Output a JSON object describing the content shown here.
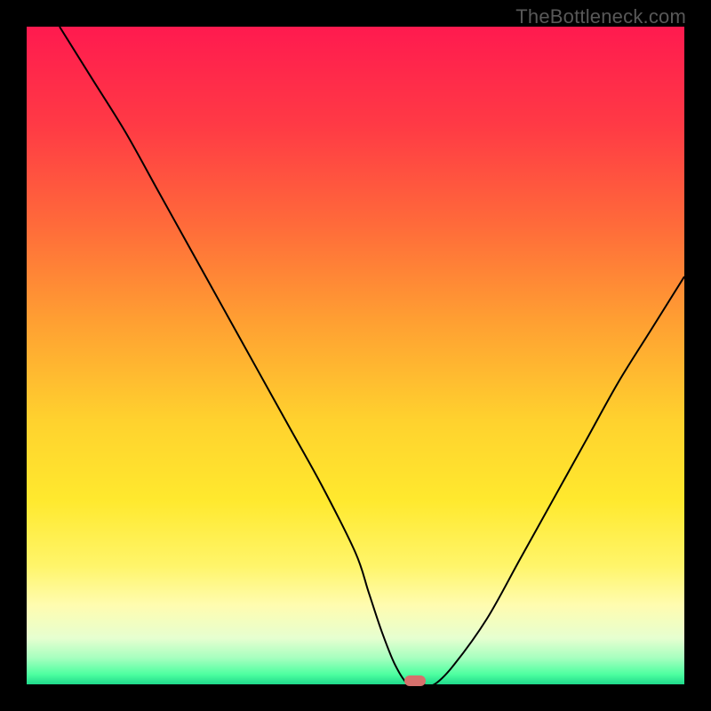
{
  "watermark": "TheBottleneck.com",
  "colors": {
    "curve": "#000000",
    "marker": "#d6706c",
    "gradient_stops": [
      {
        "offset": 0.0,
        "color": "#ff1a4f"
      },
      {
        "offset": 0.15,
        "color": "#ff3a45"
      },
      {
        "offset": 0.3,
        "color": "#ff6a3a"
      },
      {
        "offset": 0.45,
        "color": "#ffa032"
      },
      {
        "offset": 0.6,
        "color": "#ffd22e"
      },
      {
        "offset": 0.72,
        "color": "#ffe92e"
      },
      {
        "offset": 0.82,
        "color": "#fff56a"
      },
      {
        "offset": 0.88,
        "color": "#fffcb0"
      },
      {
        "offset": 0.93,
        "color": "#e6ffd0"
      },
      {
        "offset": 0.96,
        "color": "#a6ffbf"
      },
      {
        "offset": 0.985,
        "color": "#4dffa0"
      },
      {
        "offset": 1.0,
        "color": "#1fd98b"
      }
    ]
  },
  "chart_data": {
    "type": "line",
    "title": "",
    "xlabel": "",
    "ylabel": "",
    "xlim": [
      0,
      100
    ],
    "ylim": [
      0,
      100
    ],
    "grid": false,
    "legend": false,
    "series": [
      {
        "name": "bottleneck-curve",
        "x": [
          5,
          10,
          15,
          20,
          25,
          30,
          35,
          40,
          45,
          50,
          52,
          54,
          56,
          58,
          60,
          62,
          65,
          70,
          75,
          80,
          85,
          90,
          95,
          100
        ],
        "y": [
          100,
          92,
          84,
          75,
          66,
          57,
          48,
          39,
          30,
          20,
          14,
          8,
          3,
          0,
          0,
          0,
          3,
          10,
          19,
          28,
          37,
          46,
          54,
          62
        ]
      }
    ],
    "annotations": [
      {
        "name": "optimal-marker",
        "x": 59,
        "y": 0.5
      }
    ]
  }
}
